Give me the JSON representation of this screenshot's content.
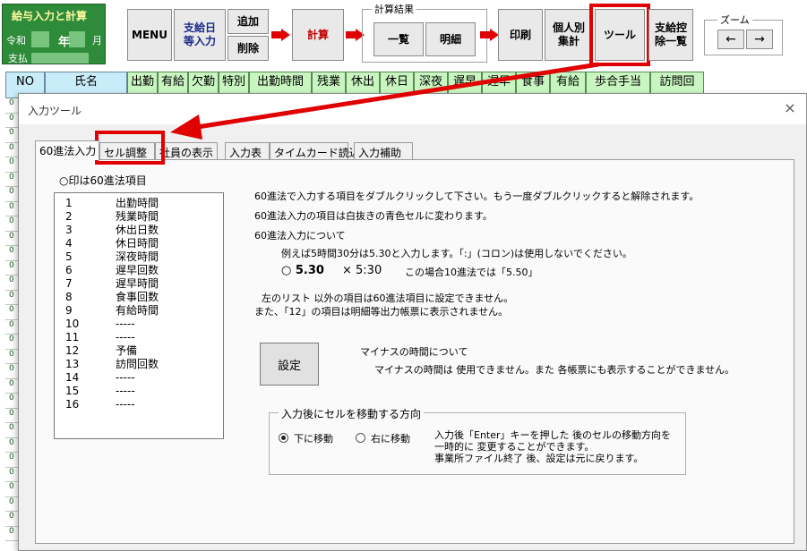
{
  "app": {
    "title": "給与入力と計算",
    "era": "令和",
    "year_label": "年",
    "month_label": "月",
    "pay_label": "支払"
  },
  "toolbar": {
    "menu": "MENU",
    "payday_input": "支給日\n等入力",
    "add": "追加",
    "delete": "削除",
    "calc": "計算",
    "results_group": "計算結果",
    "list": "一覧",
    "detail": "明細",
    "print": "印刷",
    "individual": "個人別\n集計",
    "tool": "ツール",
    "deduction_list": "支給控\n除一覧",
    "zoom_group": "ズーム",
    "zoom_out": "←",
    "zoom_in": "→"
  },
  "sheet": {
    "headers": [
      "NO",
      "氏名",
      "出勤",
      "有給",
      "欠勤",
      "特別",
      "出勤時間",
      "残業",
      "休出",
      "休日",
      "深夜",
      "遅早",
      "遅早",
      "食事",
      "有給",
      "歩合手当",
      "訪問回"
    ],
    "row_marker": "0"
  },
  "dialog": {
    "title": "入力ツール",
    "close": "×",
    "tabs": [
      "60進法入力",
      "セル調整",
      "社員の表示",
      "入力表",
      "タイムカード読込",
      "入力補助"
    ],
    "note": "○印は60進法項目",
    "items": [
      {
        "n": "1",
        "v": "出勤時間"
      },
      {
        "n": "2",
        "v": "残業時間"
      },
      {
        "n": "3",
        "v": "休出日数"
      },
      {
        "n": "4",
        "v": "休日時間"
      },
      {
        "n": "5",
        "v": "深夜時間"
      },
      {
        "n": "6",
        "v": "遅早回数"
      },
      {
        "n": "7",
        "v": "遅早時間"
      },
      {
        "n": "8",
        "v": "食事回数"
      },
      {
        "n": "9",
        "v": "有給時間"
      },
      {
        "n": "10",
        "v": "-----"
      },
      {
        "n": "11",
        "v": "-----"
      },
      {
        "n": "12",
        "v": "予備"
      },
      {
        "n": "13",
        "v": "訪問回数"
      },
      {
        "n": "14",
        "v": "-----"
      },
      {
        "n": "15",
        "v": "-----"
      },
      {
        "n": "16",
        "v": "-----"
      }
    ],
    "text1": "60進法で入力する項目をダブルクリックして下さい。もう一度ダブルクリックすると解除されます。",
    "text2": "60進法入力の項目は白抜きの青色セルに変わります。",
    "text3": "60進法入力について",
    "text4": "例えば5時間30分は5.30と入力します。「:」(コロン)は使用しないでください。",
    "ok_example": "○  5.30",
    "ng_example": "×  5:30",
    "example_note": "この場合10進法では「5.50」",
    "text5": "左のリスト 以外の項目は60進法項目に設定できません。",
    "text6": "また、「12」の項目は明細等出力帳票に表示されません。",
    "set_button": "設定",
    "minus_title": "マイナスの時間について",
    "minus_text": "マイナスの時間は 使用できません。また 各帳票にも表示することができません。",
    "move_group": "入力後にセルを移動する方向",
    "move_down": "下に移動",
    "move_right": "右に移動",
    "move_desc1": "入力後「Enter」キーを押した 後のセルの移動方向を",
    "move_desc2": "一時的に 変更することができます。",
    "move_desc3": "事業所ファイル終了 後、設定は元に戻ります。"
  }
}
